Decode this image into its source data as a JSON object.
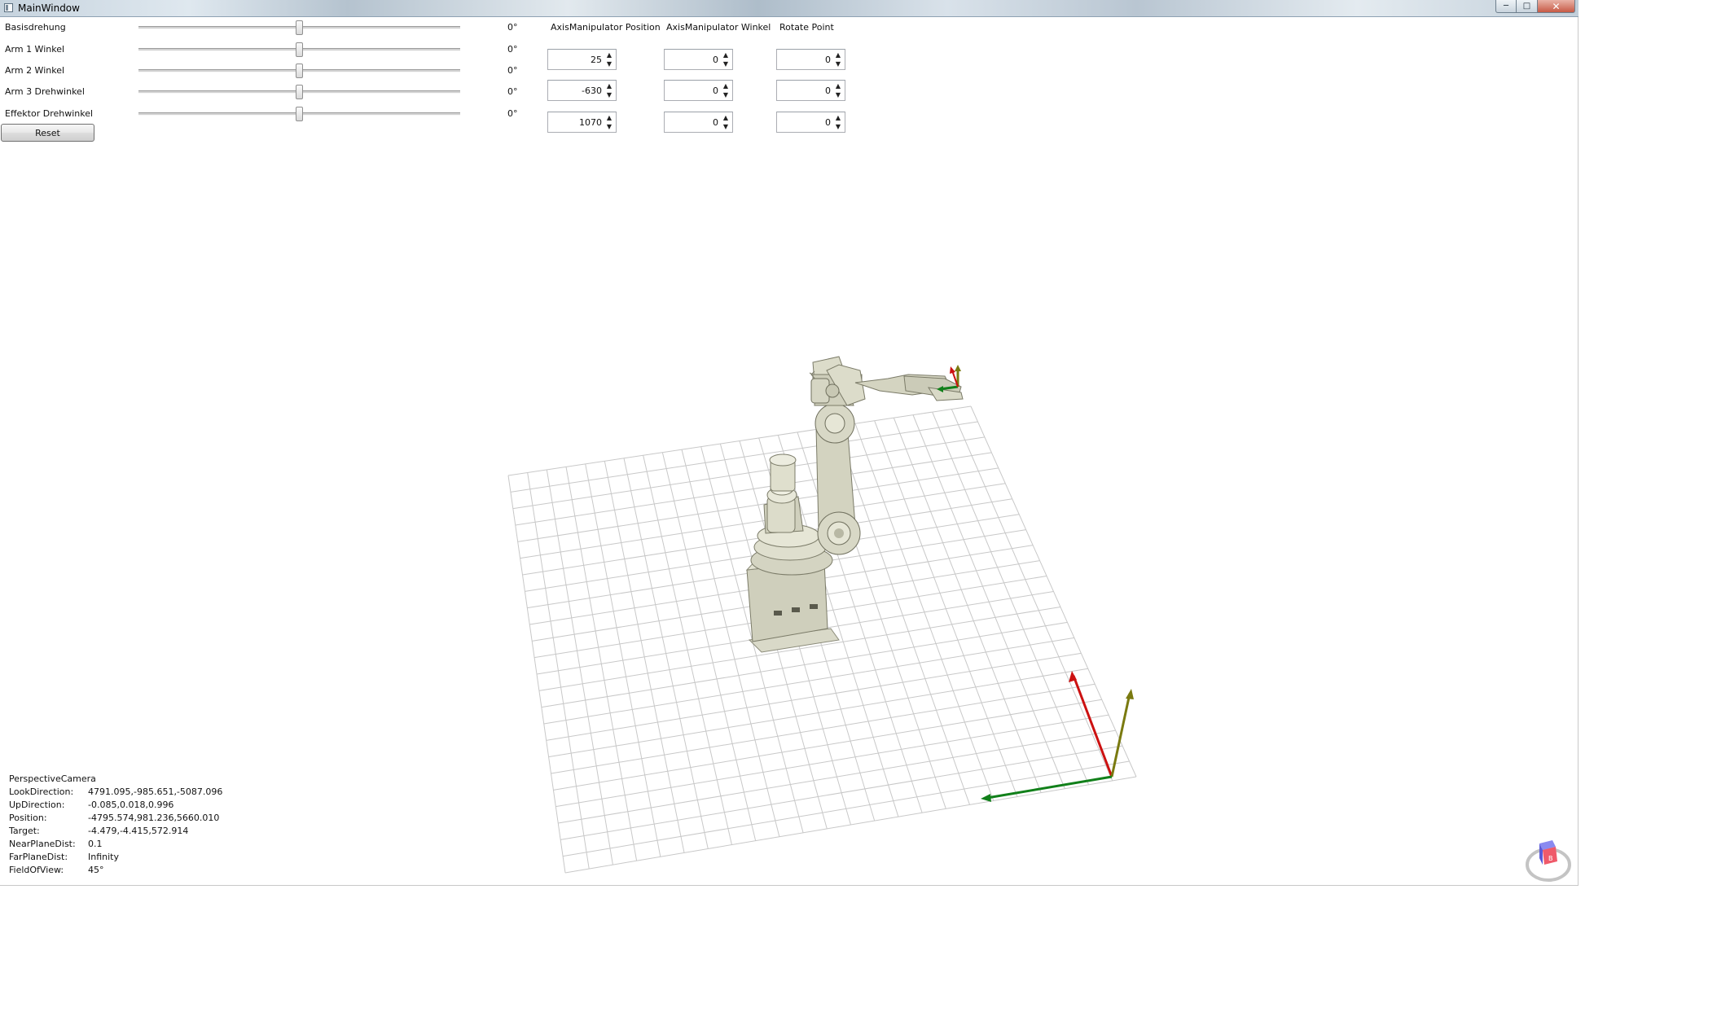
{
  "window": {
    "title": "MainWindow",
    "minimize": "─",
    "maximize": "□",
    "close": "✕"
  },
  "controls": [
    {
      "label": "Basisdrehung",
      "slider_value": 0.5,
      "angle": "0°"
    },
    {
      "label": "Arm 1 Winkel",
      "slider_value": 0.5,
      "angle": "0°"
    },
    {
      "label": "Arm 2 Winkel",
      "slider_value": 0.5,
      "angle": "0°"
    },
    {
      "label": "Arm 3 Drehwinkel",
      "slider_value": 0.5,
      "angle": "0°"
    },
    {
      "label": "Effektor Drehwinkel",
      "slider_value": 0.5,
      "angle": "0°"
    }
  ],
  "reset_label": "Reset",
  "columns": [
    {
      "header": "AxisManipulator Position",
      "values": [
        "25",
        "-630",
        "1070"
      ]
    },
    {
      "header": "AxisManipulator Winkel",
      "values": [
        "0",
        "0",
        "0"
      ]
    },
    {
      "header": "Rotate Point",
      "values": [
        "0",
        "0",
        "0"
      ]
    }
  ],
  "camera": {
    "title": "PerspectiveCamera",
    "rows": [
      {
        "key": "LookDirection:",
        "value": "4791.095,-985.651,-5087.096"
      },
      {
        "key": "UpDirection:",
        "value": "-0.085,0.018,0.996"
      },
      {
        "key": "Position:",
        "value": "-4795.574,981.236,5660.010"
      },
      {
        "key": "Target:",
        "value": "-4.479,-4.415,572.914"
      },
      {
        "key": "NearPlaneDist:",
        "value": "0.1"
      },
      {
        "key": "FarPlaneDist:",
        "value": "Infinity"
      },
      {
        "key": "FieldOfView:",
        "value": "45°"
      }
    ]
  },
  "view_cube": {
    "label": "B"
  },
  "colors": {
    "axis_x": "#cc1111",
    "axis_y": "#11801a",
    "axis_z": "#7a7a10",
    "grid": "#c8c8c8",
    "robot": "#d6d6c4"
  }
}
